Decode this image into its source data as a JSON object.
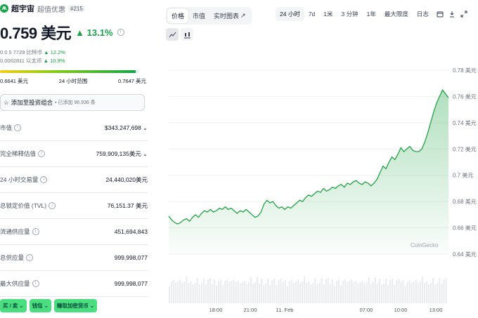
{
  "coin": {
    "name": "超宇宙",
    "tag": "超值优惠",
    "rank": "#215",
    "price": "0.759 美元",
    "change_pct": "13.1%",
    "btc_price": "0.0 5 7729 比特币",
    "btc_change": "12.2%",
    "eth_price": "0.0002811 以太币",
    "eth_change": "10.9%"
  },
  "range_24h": {
    "low": "0.6641 美元",
    "label": "24 小时范围",
    "high": "0.7647 美元",
    "position": 0.98
  },
  "portfolio": {
    "label": "添加至投资组合",
    "added": "• 已添加 96,936 条"
  },
  "stats": [
    {
      "label": "市值",
      "value": "$343,247,698",
      "dropdown": true
    },
    {
      "label": "完全稀释估值",
      "value": "759,909,135美元",
      "dropdown": true
    },
    {
      "label": "24 小时交易量",
      "value": "24,440,020美元",
      "dropdown": false
    },
    {
      "label": "总锁定价值 (TVL)",
      "value": "76,151.37 美元",
      "dropdown": false
    },
    {
      "label": "流通供应量",
      "value": "451,694,843",
      "dropdown": false
    },
    {
      "label": "总供应量",
      "value": "999,998,077",
      "dropdown": false
    },
    {
      "label": "最大供应量",
      "value": "999,998,077",
      "dropdown": false
    }
  ],
  "buttons": {
    "buy_sell": "买 / 卖",
    "wallet": "钱包",
    "earn": "赚取加密货币"
  },
  "chart_tabs": [
    "价格",
    "市值",
    "实时图表"
  ],
  "time_ranges": [
    "24 小时",
    "7d",
    "1米",
    "3 分钟",
    "1年",
    "最大限度",
    "日志"
  ],
  "icons": {
    "info": "info-icon",
    "star": "star-icon",
    "external": "external-link-icon",
    "calendar": "calendar-icon",
    "download": "download-icon",
    "expand": "expand-icon",
    "line": "line-chart-icon",
    "candle": "candlestick-icon"
  },
  "colors": {
    "accent": "#16a34a",
    "up": "#16a34a",
    "line": "#22a447",
    "button": "#4ade80"
  },
  "watermark": "CoinGecko",
  "chart_data": {
    "type": "area",
    "title": "",
    "xlabel": "",
    "ylabel": "",
    "x_ticks": [
      "18:00",
      "21:00",
      "11. Feb",
      "07:00",
      "10:00",
      "13:00"
    ],
    "y_ticks": [
      "0.78 美元",
      "0.76 美元",
      "0.74 美元",
      "0.72 美元",
      "0.7 美元",
      "0.68 美元",
      "0.66 美元",
      "0.64 美元"
    ],
    "y_tick_values": [
      0.78,
      0.76,
      0.74,
      0.72,
      0.7,
      0.68,
      0.66,
      0.64
    ],
    "ylim": [
      0.64,
      0.78
    ],
    "grid": true,
    "series": [
      {
        "values": [
          0.669,
          0.666,
          0.664,
          0.663,
          0.664,
          0.666,
          0.667,
          0.665,
          0.668,
          0.67,
          0.668,
          0.671,
          0.673,
          0.672,
          0.674,
          0.672,
          0.673,
          0.675,
          0.674,
          0.676,
          0.674,
          0.675,
          0.673,
          0.671,
          0.673,
          0.672,
          0.674,
          0.672,
          0.67,
          0.668,
          0.669,
          0.672,
          0.678,
          0.681,
          0.679,
          0.68,
          0.677,
          0.675,
          0.676,
          0.674,
          0.676,
          0.675,
          0.677,
          0.679,
          0.681,
          0.68,
          0.683,
          0.685,
          0.684,
          0.686,
          0.688,
          0.687,
          0.69,
          0.688,
          0.689,
          0.691,
          0.69,
          0.692,
          0.693,
          0.691,
          0.694,
          0.693,
          0.695,
          0.696,
          0.694,
          0.693,
          0.695,
          0.694,
          0.692,
          0.694,
          0.697,
          0.702,
          0.707,
          0.705,
          0.71,
          0.714,
          0.712,
          0.716,
          0.721,
          0.718,
          0.72,
          0.722,
          0.719,
          0.718,
          0.718,
          0.72,
          0.725,
          0.732,
          0.74,
          0.748,
          0.755,
          0.76,
          0.765,
          0.762,
          0.759
        ]
      }
    ]
  }
}
